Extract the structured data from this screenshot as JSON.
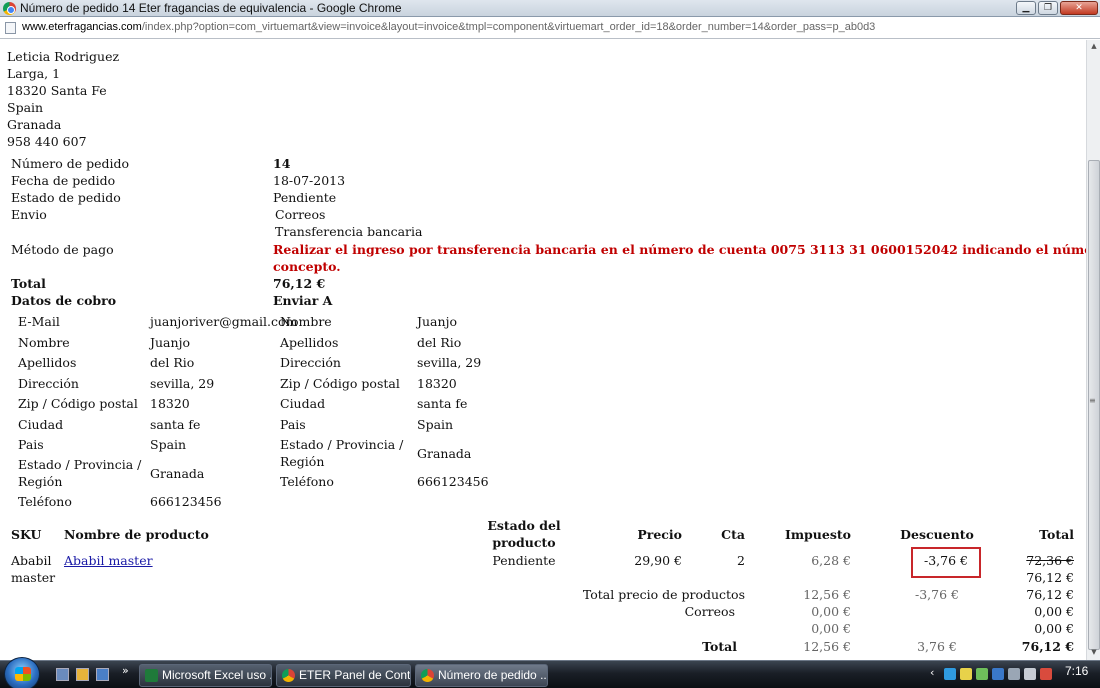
{
  "window": {
    "title": "Número de pedido 14 Eter fragancias de equivalencia - Google Chrome",
    "url_domain": "www.eterfragancias.com",
    "url_path": "/index.php?option=com_virtuemart&view=invoice&layout=invoice&tmpl=component&virtuemart_order_id=18&order_number=14&order_pass=p_ab0d3"
  },
  "address": {
    "line1": "Leticia Rodriguez",
    "line2": "Larga, 1",
    "line3": "18320 Santa Fe",
    "line4": "Spain",
    "line5": "Granada",
    "line6": "958 440 607"
  },
  "order": {
    "number_label": "Número de pedido",
    "number_value": "14",
    "date_label": "Fecha de pedido",
    "date_value": "18-07-2013",
    "status_label": "Estado de pedido",
    "status_value": "Pendiente",
    "shipping_label": "Envio",
    "shipping_value": "Correos",
    "payment_label": "Método de pago",
    "payment_method": "Transferencia bancaria",
    "payment_note_1": "Realizar el ingreso por transferencia bancaria en el número de cuenta 0075 3113 31 0600152042 indicando el número de pedido en el",
    "payment_note_2": "concepto.",
    "total_label": "Total",
    "total_value": "76,12 €"
  },
  "billing": {
    "heading": "Datos de cobro",
    "email_label": "E-Mail",
    "email_value": "juanjoriver@gmail.com",
    "name_label": "Nombre",
    "name_value": "Juanjo",
    "surname_label": "Apellidos",
    "surname_value": "del Rio",
    "address_label": "Dirección",
    "address_value": "sevilla, 29",
    "zip_label": "Zip / Código postal",
    "zip_value": "18320",
    "city_label": "Ciudad",
    "city_value": "santa fe",
    "country_label": "Pais",
    "country_value": "Spain",
    "state_label_1": "Estado / Provincia /",
    "state_label_2": "Región",
    "state_value": "Granada",
    "phone_label": "Teléfono",
    "phone_value": "666123456"
  },
  "shipping": {
    "heading": "Enviar A",
    "name_label": "Nombre",
    "name_value": "Juanjo",
    "surname_label": "Apellidos",
    "surname_value": "del Rio",
    "address_label": "Dirección",
    "address_value": "sevilla, 29",
    "zip_label": "Zip / Código postal",
    "zip_value": "18320",
    "city_label": "Ciudad",
    "city_value": "santa fe",
    "country_label": "Pais",
    "country_value": "Spain",
    "state_label_1": "Estado / Provincia /",
    "state_label_2": "Región",
    "state_value": "Granada",
    "phone_label": "Teléfono",
    "phone_value": "666123456"
  },
  "items": {
    "headers": {
      "sku": "SKU",
      "name": "Nombre de producto",
      "status_1": "Estado del",
      "status_2": "producto",
      "price": "Precio",
      "qty": "Cta",
      "tax": "Impuesto",
      "discount": "Descuento",
      "total": "Total"
    },
    "row": {
      "sku_1": "Ababil",
      "sku_2": "master",
      "name": "Ababil master",
      "status": "Pendiente",
      "price": "29,90 €",
      "qty": "2",
      "tax": "6,28 €",
      "discount": "-3,76 €",
      "total_old": "72,36 €",
      "total_new": "76,12 €"
    }
  },
  "summary": {
    "products_label": "Total precio de productos",
    "products_tax": "12,56 €",
    "products_discount": "-3,76 €",
    "products_total": "76,12 €",
    "shipping_label": "Correos",
    "shipping_tax": "0,00 €",
    "shipping_total": "0,00 €",
    "extra_tax": "0,00 €",
    "extra_total": "0,00 €",
    "grand_label": "Total",
    "grand_tax": "12,56 €",
    "grand_discount": "3,76 €",
    "grand_total": "76,12 €"
  },
  "taskbar": {
    "task1": "Microsoft Excel uso ...",
    "task2": "ETER Panel de Contr...",
    "task3": "Número de pedido ...",
    "chevron": "»",
    "clock": "7:16"
  }
}
